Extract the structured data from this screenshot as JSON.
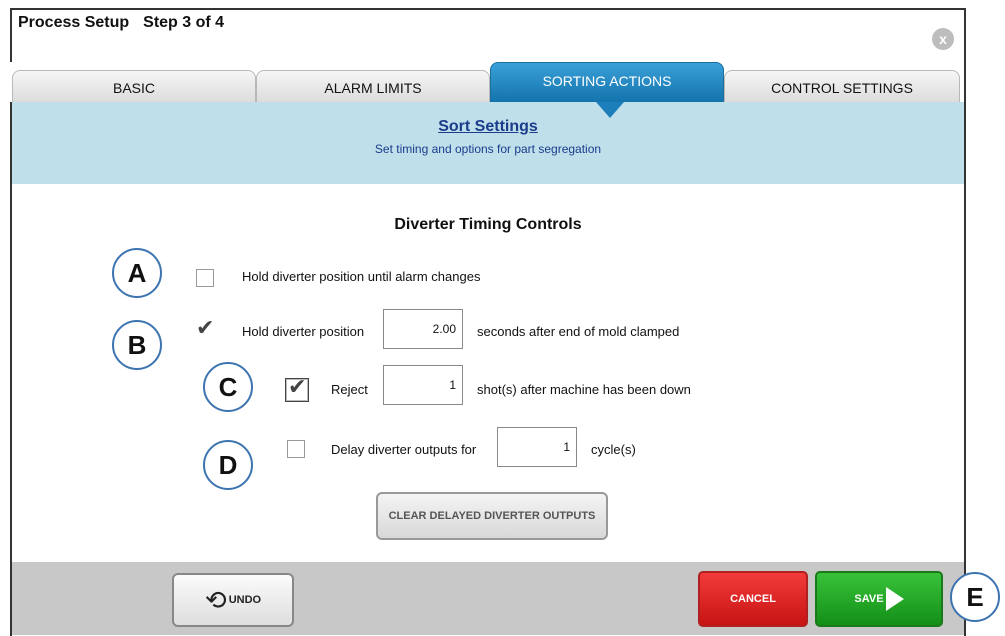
{
  "window": {
    "title": "Process Setup",
    "step": "Step 3 of 4",
    "close_icon": "x"
  },
  "tabs": [
    {
      "label": "BASIC"
    },
    {
      "label": "ALARM LIMITS"
    },
    {
      "label": "SORTING ACTIONS",
      "active": true
    },
    {
      "label": "CONTROL SETTINGS"
    }
  ],
  "banner": {
    "heading": "Sort Settings",
    "subheading": "Set timing and options for part segregation"
  },
  "section_title": "Diverter Timing Controls",
  "callouts": {
    "a": "A",
    "b": "B",
    "c": "C",
    "d": "D",
    "e": "E"
  },
  "options": {
    "hold_until_alarm": {
      "label": "Hold diverter position until alarm changes",
      "checked": false
    },
    "hold_position": {
      "label": "Hold diverter position",
      "value": "2.00",
      "suffix": "seconds after end of mold clamped",
      "checked": true
    },
    "reject": {
      "label": "Reject",
      "value": "1",
      "suffix": "shot(s) after machine has been down",
      "checked": true
    },
    "delay": {
      "label": "Delay diverter outputs for",
      "value": "1",
      "suffix": "cycle(s)",
      "checked": false
    }
  },
  "buttons": {
    "clear_label": "CLEAR DELAYED DIVERTER OUTPUTS",
    "undo_label": "UNDO",
    "cancel_label": "CANCEL",
    "save_label": "SAVE"
  },
  "colors": {
    "tab_active": "#1c7fbb",
    "banner_bg": "#bfe0eb",
    "cancel": "#d82020",
    "save": "#22a524",
    "callout_border": "#3d74b0"
  }
}
